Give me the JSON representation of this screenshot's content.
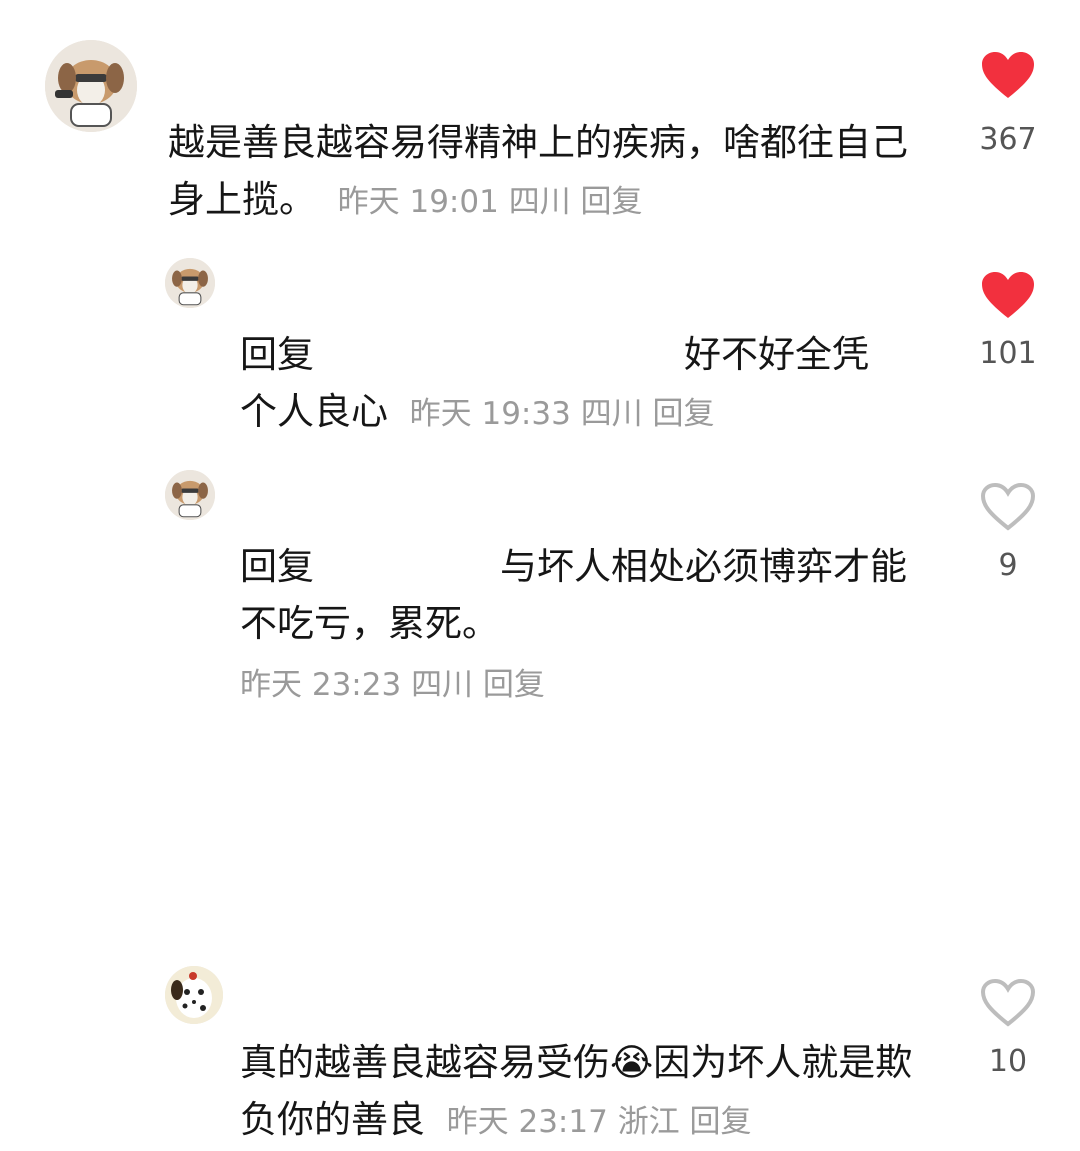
{
  "colors": {
    "like_active": "#f2303e",
    "like_outline": "#bdbdbd",
    "meta": "#9a9a9a"
  },
  "comments": [
    {
      "text": "越是善良越容易得精神上的疾病，啥都往自己身上揽。",
      "time": "昨天 19:01",
      "location": "四川",
      "reply": "回复",
      "likes": "367",
      "liked": true,
      "avatar_icon": "dog-avatar-icon"
    },
    {
      "reply_prefix": "回复",
      "text": "好不好全凭个人良心",
      "time": "昨天 19:33",
      "location": "四川",
      "reply": "回复",
      "likes": "101",
      "liked": true,
      "avatar_icon": "dog-avatar-icon"
    },
    {
      "reply_prefix": "回复",
      "text": "与坏人相处必须博弈才能不吃亏，累死。",
      "time": "昨天 23:23",
      "location": "四川",
      "reply": "回复",
      "likes": "9",
      "liked": false,
      "avatar_icon": "dog-avatar-icon"
    },
    {
      "text_part1": "真的越善良越容易受伤",
      "emoji": "😭",
      "text_part2": "因为坏人就是欺负你的善良",
      "time": "昨天 23:17",
      "location": "浙江",
      "reply": "回复",
      "likes": "10",
      "liked": false,
      "avatar_icon": "dalmatian-avatar-icon"
    }
  ]
}
